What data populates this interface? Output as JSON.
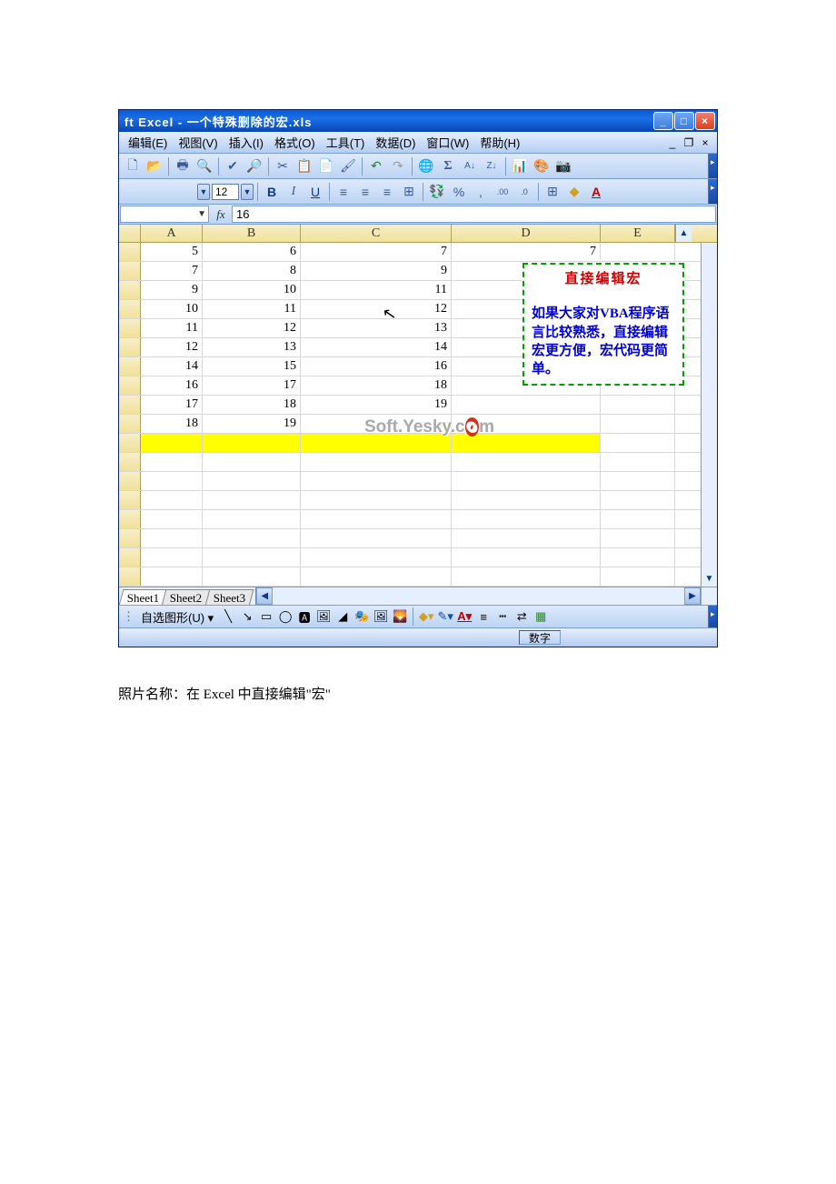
{
  "window": {
    "title": "ft Excel - 一个特殊删除的宏.xls"
  },
  "menus": [
    "编辑(E)",
    "视图(V)",
    "插入(I)",
    "格式(O)",
    "工具(T)",
    "数据(D)",
    "窗口(W)",
    "帮助(H)"
  ],
  "font_size": "12",
  "formula": {
    "name_box": "",
    "value": "16"
  },
  "columns": [
    "A",
    "B",
    "C",
    "D",
    "E"
  ],
  "rows": [
    {
      "A": "5",
      "B": "6",
      "C": "7",
      "D": "7",
      "E": ""
    },
    {
      "A": "7",
      "B": "8",
      "C": "9",
      "D": "",
      "E": ""
    },
    {
      "A": "9",
      "B": "10",
      "C": "11",
      "D": "",
      "E": ""
    },
    {
      "A": "10",
      "B": "11",
      "C": "12",
      "D": "",
      "E": ""
    },
    {
      "A": "11",
      "B": "12",
      "C": "13",
      "D": "",
      "E": ""
    },
    {
      "A": "12",
      "B": "13",
      "C": "14",
      "D": "",
      "E": ""
    },
    {
      "A": "14",
      "B": "15",
      "C": "16",
      "D": "",
      "E": ""
    },
    {
      "A": "16",
      "B": "17",
      "C": "18",
      "D": "",
      "E": ""
    },
    {
      "A": "17",
      "B": "18",
      "C": "19",
      "D": "",
      "E": ""
    },
    {
      "A": "18",
      "B": "19",
      "C": "",
      "D": "",
      "E": ""
    }
  ],
  "empty_rows_after": 8,
  "yellow_row_index": 10,
  "callout": {
    "title": "直接编辑宏",
    "body": "如果大家对VBA程序语言比较熟悉，直接编辑宏更方便，宏代码更简单。"
  },
  "watermark": "Soft.Yesky.c🅞m",
  "sheets": [
    "Sheet1",
    "Sheet2",
    "Sheet3"
  ],
  "drawing_label": "自选图形(U)",
  "status": "数字",
  "caption": "照片名称：在 Excel 中直接编辑\"宏\""
}
